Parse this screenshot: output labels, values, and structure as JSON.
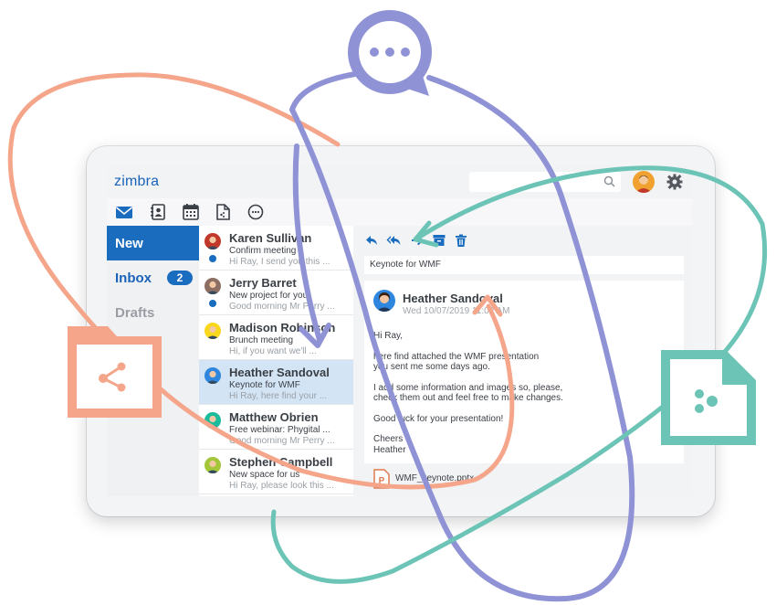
{
  "app": {
    "logo": "zimbra"
  },
  "search": {
    "placeholder": ""
  },
  "apps": [
    "mail-icon",
    "contacts-icon",
    "calendar-icon",
    "files-icon",
    "chat-icon"
  ],
  "sidebar": {
    "items": [
      {
        "label": "New"
      },
      {
        "label": "Inbox",
        "badge": "2"
      },
      {
        "label": "Drafts"
      }
    ]
  },
  "messages": [
    {
      "name": "Karen Sullivan",
      "subject": "Confirm meeting",
      "preview": "Hi Ray, I send you this ...",
      "unread": true,
      "avatar_color": "#c0392b"
    },
    {
      "name": "Jerry Barret",
      "subject": "New project for your",
      "preview": "Good morning Mr Perry ...",
      "unread": true,
      "avatar_color": "#8d6e63"
    },
    {
      "name": "Madison Robinson",
      "subject": "Brunch meeting",
      "preview": "Hi, if you want we'll ...",
      "unread": false,
      "avatar_color": "#f9d71c"
    },
    {
      "name": "Heather Sandoval",
      "subject": "Keynote for WMF",
      "preview": "Hi Ray, here find your ...",
      "unread": false,
      "selected": true,
      "avatar_color": "#2e86de"
    },
    {
      "name": "Matthew Obrien",
      "subject": "Free webinar: Phygital ...",
      "preview": "Good morning Mr Perry ...",
      "unread": false,
      "avatar_color": "#1abc9c"
    },
    {
      "name": "Stephen Campbell",
      "subject": "New space for us",
      "preview": "Hi Ray, please look this ...",
      "unread": false,
      "avatar_color": "#a4c639"
    }
  ],
  "reader": {
    "subject": "Keynote for WMF",
    "from": "Heather Sandoval",
    "date": "Wed 10/07/2019 11:02 AM",
    "body": [
      "Hi Ray,",
      "here find attached the WMF presentation\nyou sent me some days ago.",
      "I add some information and images so, please,\ncheck them out and feel free to make changes.",
      "Good luck for your presentation!",
      "Cheers\nHeather"
    ],
    "attachment": "WMF_keynote.pptx"
  },
  "colors": {
    "accent": "#1a6cbf",
    "salmon": "#f4a58a",
    "purple": "#8f93d6",
    "teal": "#6cc4b6"
  }
}
